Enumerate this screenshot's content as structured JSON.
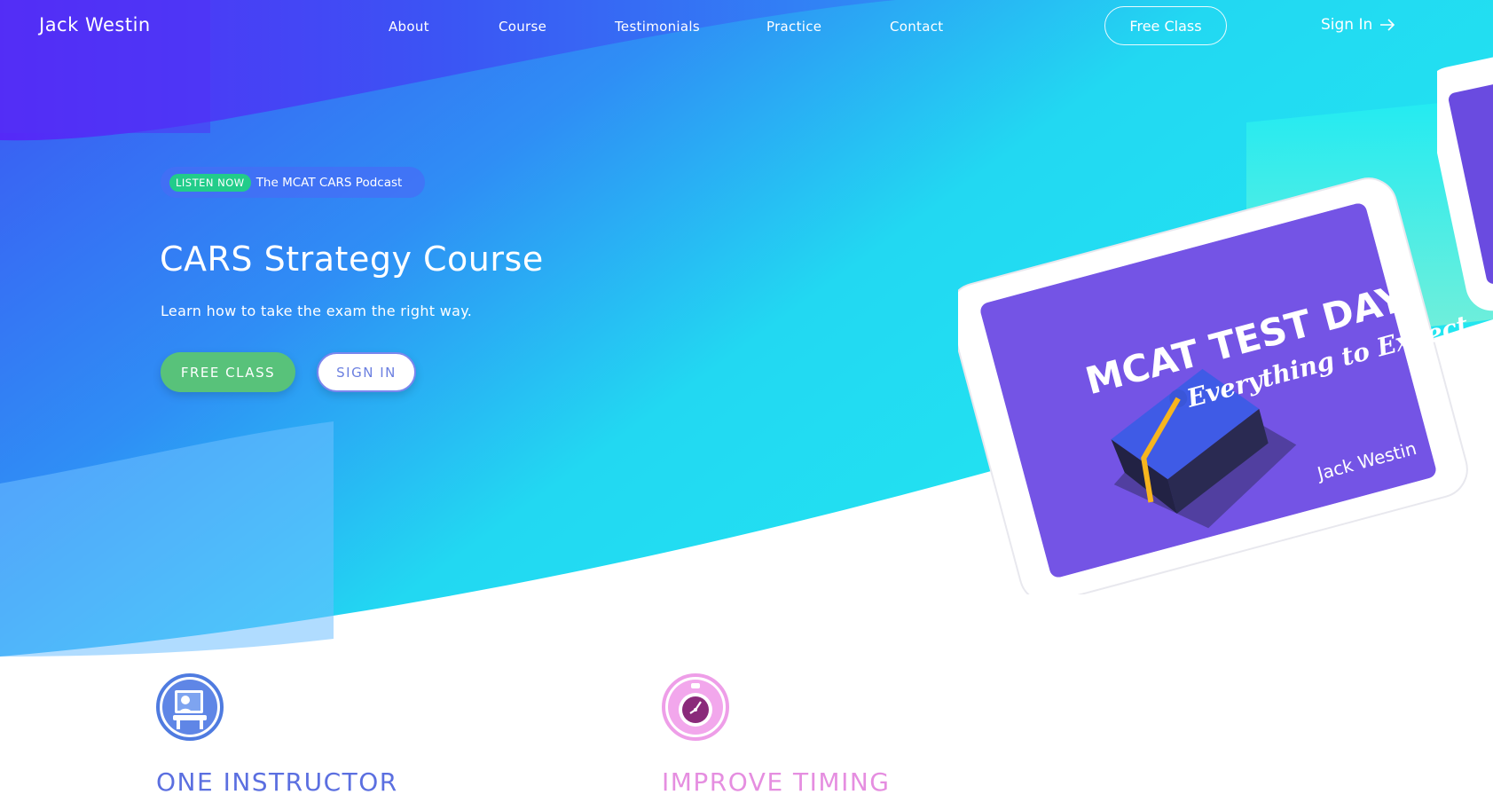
{
  "nav": {
    "brand": "Jack Westin",
    "links": [
      "About",
      "Course",
      "Testimonials",
      "Practice",
      "Contact"
    ],
    "free_class": "Free Class",
    "sign_in": "Sign In"
  },
  "hero": {
    "badge": "LISTEN NOW",
    "podcast": "The MCAT CARS Podcast",
    "title": "CARS Strategy Course",
    "subtitle": "Learn how to take the exam the right way.",
    "free_class_button": "FREE CLASS",
    "sign_in_button": "SIGN IN"
  },
  "tablet": {
    "headline": "MCAT TEST DAY",
    "script": "Everything to Expect",
    "author": "Jack Westin"
  },
  "features": [
    {
      "title": "ONE INSTRUCTOR",
      "icon": "instructor-icon",
      "color": "#5b6fe0"
    },
    {
      "title": "IMPROVE TIMING",
      "icon": "stopwatch-icon",
      "color": "#e58ee0"
    }
  ],
  "colors": {
    "gradient_start": "#4a2cf5",
    "gradient_mid": "#2f8ef5",
    "gradient_end": "#22e4f0",
    "accent_green": "#58c27a",
    "badge_green": "#22cc8a"
  }
}
